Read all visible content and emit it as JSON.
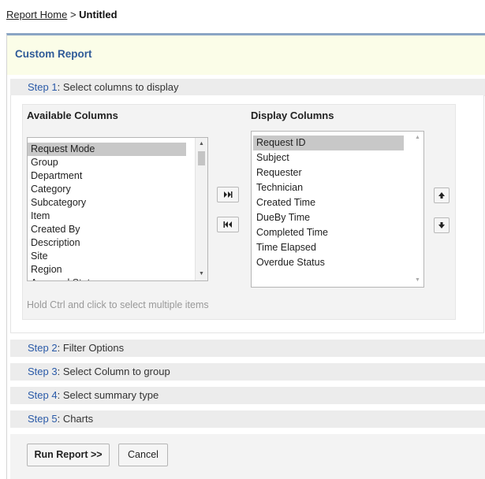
{
  "breadcrumb": {
    "home": "Report Home",
    "separator": ">",
    "current": "Untitled"
  },
  "panel": {
    "title": "Custom Report"
  },
  "steps": [
    {
      "num": "Step 1",
      "label": ": Select columns to display"
    },
    {
      "num": "Step 2",
      "label": ": Filter Options"
    },
    {
      "num": "Step 3",
      "label": ": Select Column to group"
    },
    {
      "num": "Step 4",
      "label": ": Select summary type"
    },
    {
      "num": "Step 5",
      "label": ": Charts"
    }
  ],
  "available": {
    "heading": "Available Columns",
    "items": [
      "Request Mode",
      "Group",
      "Department",
      "Category",
      "Subcategory",
      "Item",
      "Created By",
      "Description",
      "Site",
      "Region",
      "Approval Status"
    ],
    "selected": "Request Mode"
  },
  "display": {
    "heading": "Display Columns",
    "items": [
      "Request ID",
      "Subject",
      "Requester",
      "Technician",
      "Created Time",
      "DueBy Time",
      "Completed Time",
      "Time Elapsed",
      "Overdue Status"
    ],
    "selected": "Request ID"
  },
  "hint": "Hold Ctrl and click to select multiple items",
  "actions": {
    "run": "Run Report >>",
    "cancel": "Cancel"
  },
  "icons": {
    "move_right": "double-chevron-right-icon",
    "move_left": "double-chevron-left-icon",
    "move_up": "arrow-up-icon",
    "move_down": "arrow-down-icon"
  }
}
